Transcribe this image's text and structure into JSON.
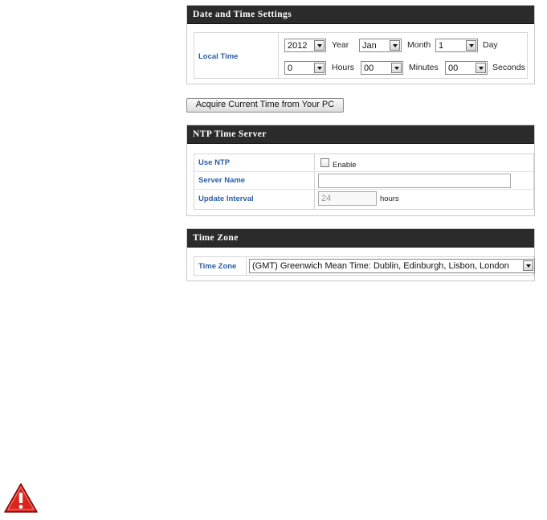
{
  "date_time": {
    "title": "Date and Time Settings",
    "local_time_label": "Local Time",
    "year_value": "2012",
    "year_label": "Year",
    "month_value": "Jan",
    "month_label": "Month",
    "day_value": "1",
    "day_label": "Day",
    "hours_value": "0",
    "hours_label": "Hours",
    "minutes_value": "00",
    "minutes_label": "Minutes",
    "seconds_value": "00",
    "seconds_label": "Seconds"
  },
  "acquire_button": "Acquire Current Time from Your PC",
  "ntp": {
    "title": "NTP Time Server",
    "use_ntp_label": "Use NTP",
    "enable_label": "Enable",
    "enable_checked": false,
    "server_name_label": "Server Name",
    "server_name_value": "",
    "update_interval_label": "Update Interval",
    "update_interval_value": "24",
    "update_interval_unit": "hours"
  },
  "timezone": {
    "title": "Time Zone",
    "label": "Time Zone",
    "value": "(GMT) Greenwich Mean Time: Dublin, Edinburgh, Lisbon, London"
  },
  "icons": {
    "warning": "warning-triangle-icon"
  },
  "colors": {
    "header_bg": "#2b2b2b",
    "label_blue": "#2a5ea8",
    "warning_red": "#d9261c"
  }
}
